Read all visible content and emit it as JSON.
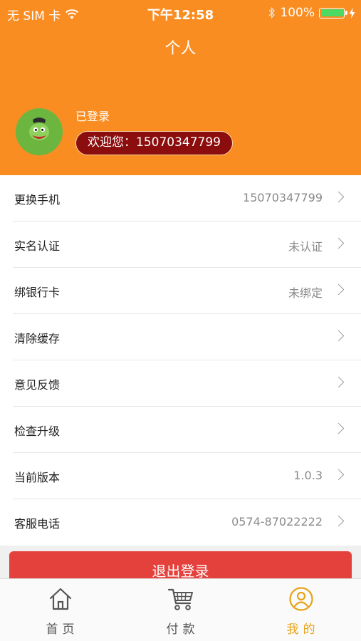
{
  "status_bar": {
    "carrier": "无 SIM 卡",
    "time": "下午12:58",
    "battery": "100%"
  },
  "header": {
    "title": "个人",
    "login_status": "已登录",
    "welcome": "欢迎您：15070347799"
  },
  "menu": {
    "items": [
      {
        "label": "更换手机",
        "value": "15070347799"
      },
      {
        "label": "实名认证",
        "value": "未认证"
      },
      {
        "label": "绑银行卡",
        "value": "未绑定"
      },
      {
        "label": "清除缓存",
        "value": ""
      },
      {
        "label": "意见反馈",
        "value": ""
      },
      {
        "label": "检查升级",
        "value": ""
      },
      {
        "label": "当前版本",
        "value": "1.0.3"
      },
      {
        "label": "客服电话",
        "value": "0574-87022222"
      }
    ]
  },
  "logout_label": "退出登录",
  "tabs": [
    {
      "label": "首页",
      "icon": "home-icon"
    },
    {
      "label": "付款",
      "icon": "cart-icon"
    },
    {
      "label": "我的",
      "icon": "user-icon"
    }
  ],
  "colors": {
    "header": "#f98d22",
    "badge": "#8b0d0d",
    "logout": "#e4403c",
    "active_tab": "#e8a317"
  }
}
